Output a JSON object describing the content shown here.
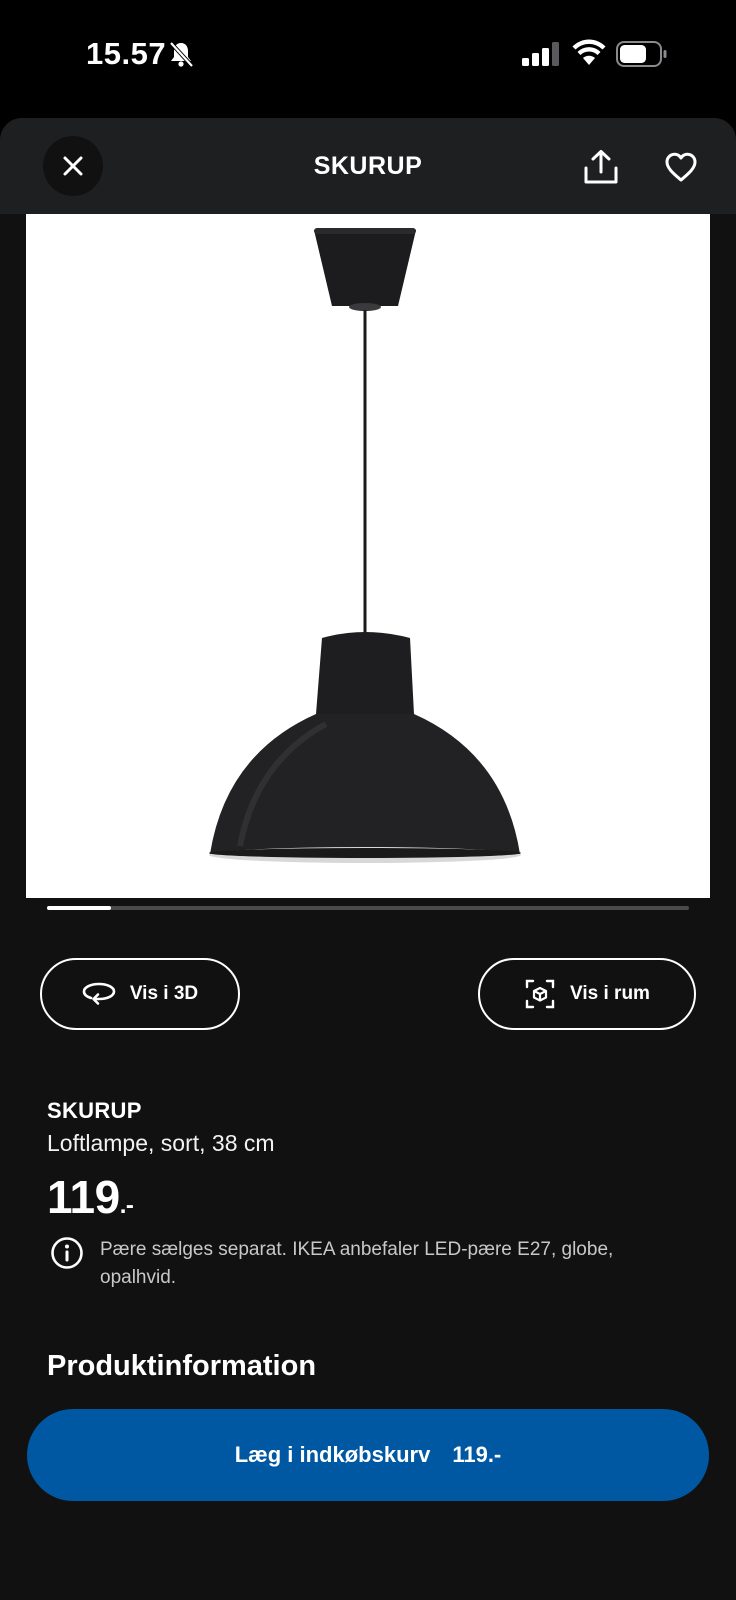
{
  "status_bar": {
    "time": "15.57"
  },
  "header": {
    "title": "SKURUP"
  },
  "carousel": {
    "current_image_fraction": 0.1
  },
  "actions": {
    "view_3d_label": "Vis i 3D",
    "view_room_label": "Vis i rum"
  },
  "product": {
    "name": "SKURUP",
    "description": "Loftlampe, sort, 38 cm",
    "price_main": "119",
    "price_suffix": ".-",
    "notice": "Pære sælges separat. IKEA anbefaler LED-pære E27, globe, opalhvid."
  },
  "sections": {
    "product_info_heading": "Produktinformation"
  },
  "cart": {
    "label": "Læg i indkøbskurv",
    "price": "119.-"
  },
  "colors": {
    "accent_blue": "#0058a3",
    "sheet_background": "#111112",
    "header_background": "#1e1f21"
  }
}
